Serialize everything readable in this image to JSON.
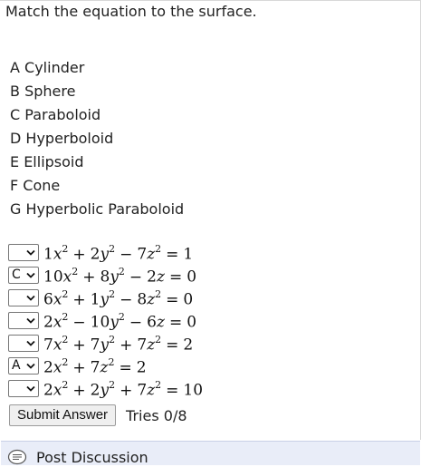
{
  "prompt": "Match the equation to the surface.",
  "options": [
    "A Cylinder",
    "B Sphere",
    "C Paraboloid",
    "D Hyperboloid",
    "E Ellipsoid",
    "F Cone",
    "G Hyperbolic Paraboloid"
  ],
  "equations": [
    {
      "selected": "",
      "terms": [
        [
          "1",
          "x"
        ],
        [
          "+",
          "2",
          "y"
        ],
        [
          "−",
          "7",
          "z"
        ]
      ],
      "rhs": "1"
    },
    {
      "selected": "C",
      "terms": [
        [
          "10",
          "x"
        ],
        [
          "+",
          "8",
          "y"
        ]
      ],
      "linear": [
        "−",
        "2",
        "z"
      ],
      "rhs": "0"
    },
    {
      "selected": "",
      "terms": [
        [
          "6",
          "x"
        ],
        [
          "+",
          "1",
          "y"
        ],
        [
          "−",
          "8",
          "z"
        ]
      ],
      "rhs": "0"
    },
    {
      "selected": "",
      "terms": [
        [
          "2",
          "x"
        ],
        [
          "−",
          "10",
          "y"
        ]
      ],
      "linear": [
        "−",
        "6",
        "z"
      ],
      "rhs": "0"
    },
    {
      "selected": "",
      "terms": [
        [
          "7",
          "x"
        ],
        [
          "+",
          "7",
          "y"
        ],
        [
          "+",
          "7",
          "z"
        ]
      ],
      "rhs": "2"
    },
    {
      "selected": "A",
      "terms": [
        [
          "2",
          "x"
        ],
        [
          "+",
          "7",
          "z"
        ]
      ],
      "rhs": "2"
    },
    {
      "selected": "",
      "terms": [
        [
          "2",
          "x"
        ],
        [
          "+",
          "2",
          "y"
        ],
        [
          "+",
          "7",
          "z"
        ]
      ],
      "rhs": "10"
    }
  ],
  "submit_label": "Submit Answer",
  "tries_text": "Tries 0/8",
  "discussion_label": "Post Discussion",
  "icons": {
    "dropdown": "chevron-down-icon",
    "discussion": "discussion-bubble-icon"
  }
}
